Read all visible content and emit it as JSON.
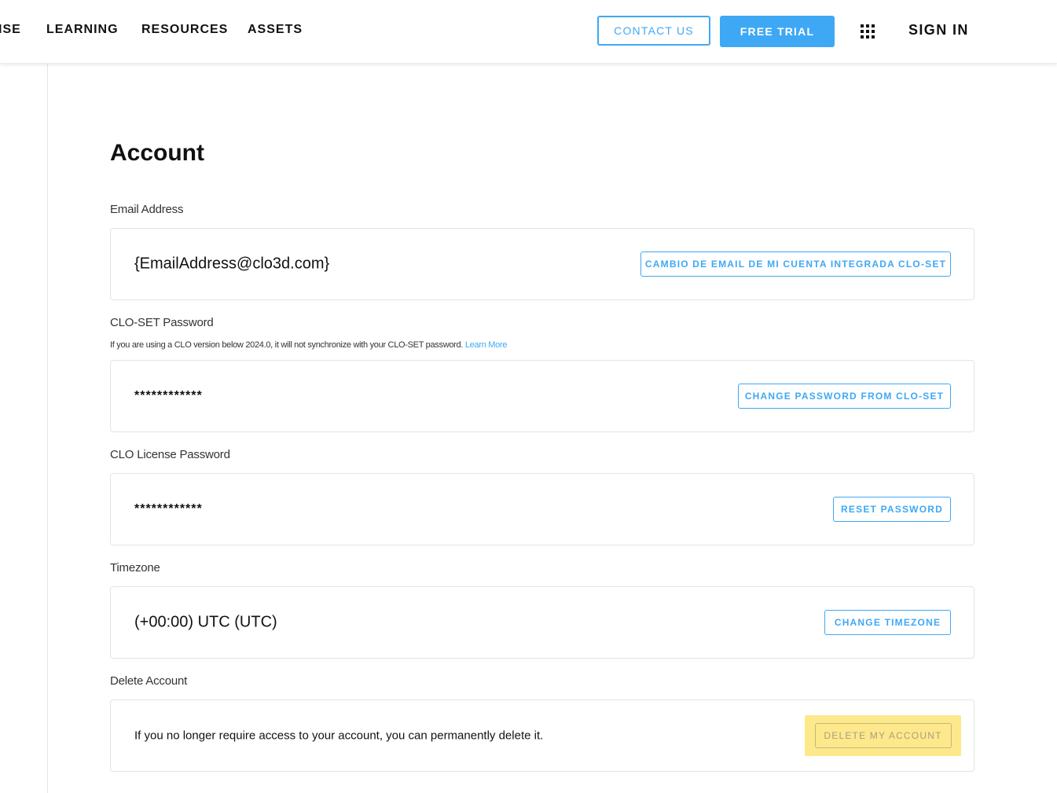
{
  "nav": {
    "items": [
      "ISE",
      "LEARNING",
      "RESOURCES",
      "ASSETS"
    ],
    "contact_label": "CONTACT US",
    "trial_label": "FREE TRIAL",
    "signin_label": "SIGN IN",
    "accent_color": "#3fa8f5"
  },
  "page": {
    "title": "Account"
  },
  "email": {
    "label": "Email Address",
    "value": "{EmailAddress@clo3d.com}",
    "button": "CAMBIO DE EMAIL DE MI CUENTA INTEGRADA CLO-SET"
  },
  "closet_password": {
    "label": "CLO-SET Password",
    "note": "If you are using a CLO version below 2024.0, it will not synchronize with your CLO-SET password.",
    "note_link": "Learn More",
    "value": "************",
    "button": "CHANGE PASSWORD FROM CLO-SET"
  },
  "license_password": {
    "label": "CLO License Password",
    "value": "************",
    "button": "RESET PASSWORD"
  },
  "timezone": {
    "label": "Timezone",
    "value": "(+00:00) UTC (UTC)",
    "button": "CHANGE TIMEZONE"
  },
  "delete_account": {
    "label": "Delete Account",
    "text": "If you no longer require access to your account, you can permanently delete it.",
    "button": "DELETE MY ACCOUNT",
    "highlight_color": "#fde98c"
  }
}
